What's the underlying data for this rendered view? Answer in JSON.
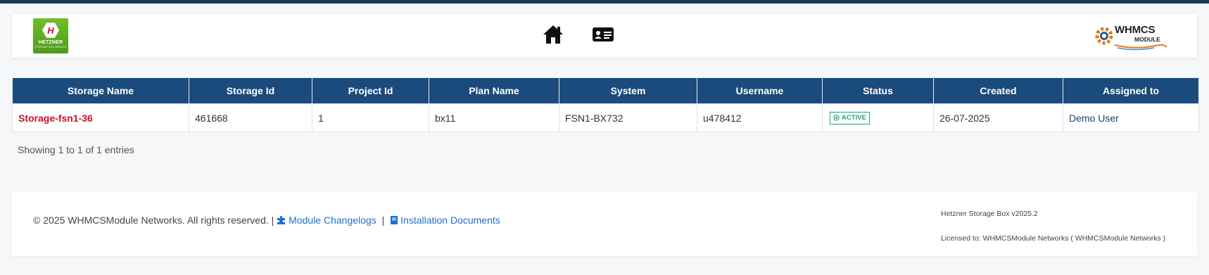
{
  "header": {
    "hetzner_logo": {
      "brand": "HETZNER",
      "tagline": "STORAGE BOX MODULE"
    },
    "nav": [
      {
        "icon": "home-icon"
      },
      {
        "icon": "id-card-icon"
      }
    ],
    "whmcs_logo": {
      "word": "WHMCS",
      "sub": "MODULE"
    }
  },
  "table": {
    "columns": [
      "Storage Name",
      "Storage Id",
      "Project Id",
      "Plan Name",
      "System",
      "Username",
      "Status",
      "Created",
      "Assigned to"
    ],
    "rows": [
      {
        "storage_name": "Storage-fsn1-36",
        "storage_id": "461668",
        "project_id": "1",
        "plan_name": "bx11",
        "system": "FSN1-BX732",
        "username": "u478412",
        "status": "ACTIVE",
        "created": "26-07-2025",
        "assigned_to": "Demo User"
      }
    ],
    "info": "Showing 1 to 1 of 1 entries"
  },
  "footer": {
    "copyright": "© 2025 WHMCSModule Networks. All rights reserved. |",
    "changelog_link": "Module Changelogs",
    "separator": "|",
    "docs_link": "Installation Documents",
    "version": "Hetzner Storage Box v2025.2",
    "license": "Licensed to: WHMCSModule Networks ( WHMCSModule Networks )"
  },
  "colors": {
    "topbar": "#1d3a57",
    "table_header": "#1b4b7c",
    "storage_name": "#c8102e",
    "status_active": "#1aa37a",
    "link": "#1f6fd1"
  }
}
